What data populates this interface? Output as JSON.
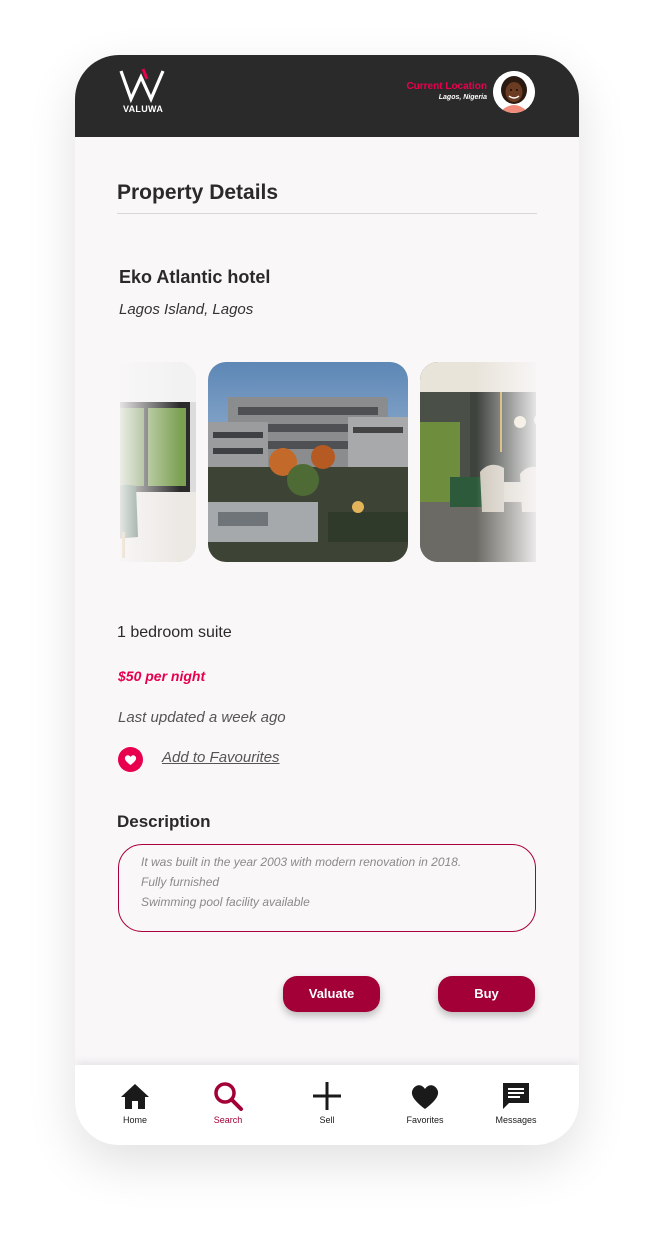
{
  "app": {
    "brand": "VALUWA"
  },
  "header": {
    "location_title": "Current Location",
    "location_city": "Lagos, Nigeria"
  },
  "page": {
    "title": "Property Details"
  },
  "property": {
    "name": "Eko Atlantic hotel",
    "location": "Lagos Island, Lagos",
    "room_type": "1 bedroom suite",
    "price": "$50 per night",
    "updated": "Last updated a week ago",
    "favourite_label": "Add to Favourites"
  },
  "description": {
    "title": "Description",
    "lines": [
      "It was built in the year 2003 with modern renovation in 2018.",
      "Fully furnished",
      "Swimming pool facility available"
    ]
  },
  "actions": {
    "valuate": "Valuate",
    "buy": "Buy"
  },
  "nav": {
    "items": [
      {
        "label": "Home",
        "icon": "home-icon"
      },
      {
        "label": "Search",
        "icon": "search-icon"
      },
      {
        "label": "Sell",
        "icon": "plus-icon"
      },
      {
        "label": "Favorites",
        "icon": "heart-icon"
      },
      {
        "label": "Messages",
        "icon": "message-icon"
      }
    ],
    "active": "Search"
  },
  "colors": {
    "accent": "#e8004f",
    "button": "#a20037",
    "header_bg": "#2b2a2b"
  }
}
